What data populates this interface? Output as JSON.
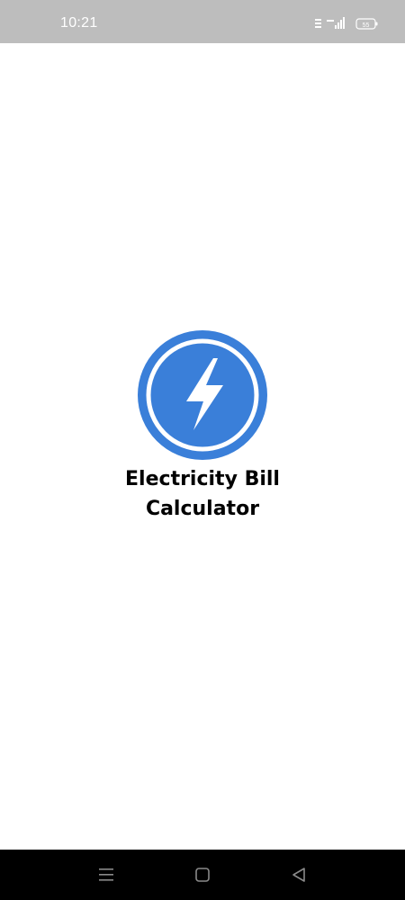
{
  "status_bar": {
    "time": "10:21",
    "icons": [
      "volte-icon",
      "signal-icon",
      "battery-icon"
    ],
    "battery_level": "55",
    "network": "4G"
  },
  "splash": {
    "logo_icon": "lightning-bolt-icon",
    "title": "Electricity Bill\nCalculator",
    "accent_color": "#3a7fd9"
  },
  "nav_bar": {
    "buttons": [
      "menu-icon",
      "home-icon",
      "back-icon"
    ]
  }
}
